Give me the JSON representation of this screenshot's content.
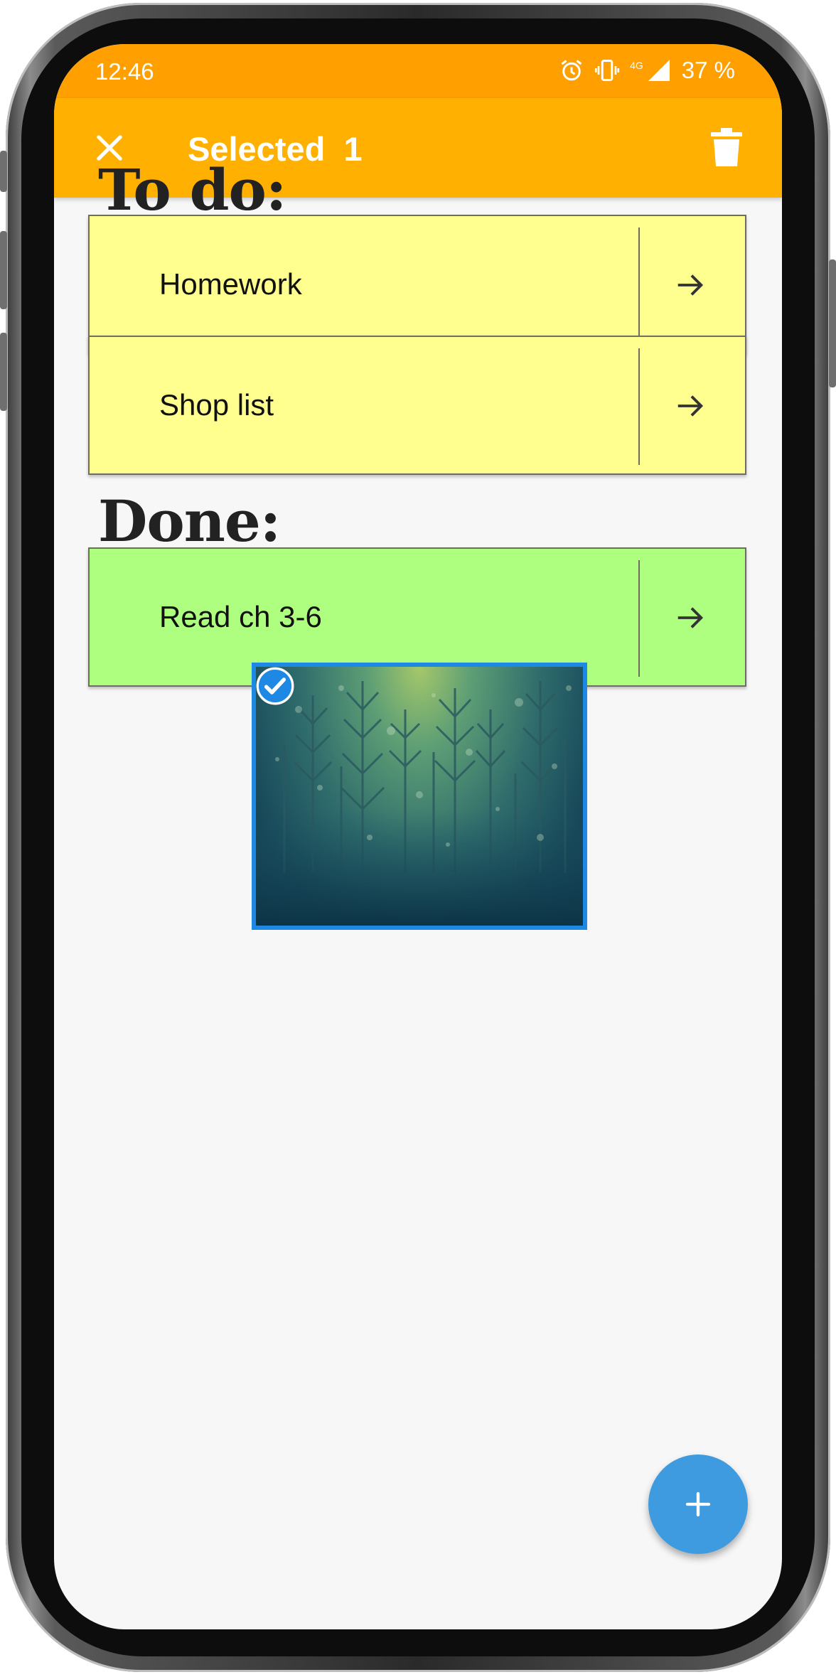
{
  "status_bar": {
    "time": "12:46",
    "network": "4G",
    "battery": "37 %"
  },
  "app_bar": {
    "title": "Selected  1",
    "close_icon": "close-icon",
    "delete_icon": "trash-icon"
  },
  "sections": {
    "todo": {
      "title": "To do:",
      "items": [
        {
          "label": "Homework"
        },
        {
          "label": "Shop list"
        }
      ]
    },
    "done": {
      "title": "Done:",
      "items": [
        {
          "label": "Read ch 3-6"
        }
      ]
    }
  },
  "image_item": {
    "selected": true,
    "icon": "check-circle-icon"
  },
  "fab": {
    "icon": "plus-icon"
  },
  "colors": {
    "status_bar": "#ff9f00",
    "app_bar": "#ffb000",
    "todo_card": "#ffff8f",
    "done_card": "#aeff80",
    "accent": "#3e9be0",
    "selection": "#1e88e5"
  }
}
